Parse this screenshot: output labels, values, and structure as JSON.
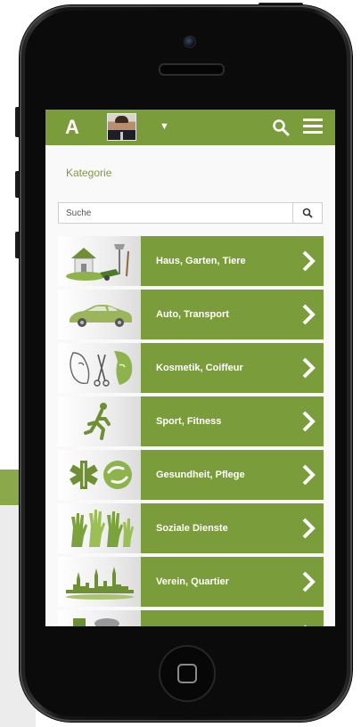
{
  "header": {
    "logo_text": "A",
    "profile_menu_caret": "▼"
  },
  "page": {
    "section_title": "Kategorie"
  },
  "search": {
    "placeholder": "Suche"
  },
  "categories": [
    {
      "label": "Haus, Garten, Tiere",
      "icon": "house-garden-icon"
    },
    {
      "label": "Auto, Transport",
      "icon": "car-icon"
    },
    {
      "label": "Kosmetik, Coiffeur",
      "icon": "cosmetics-icon"
    },
    {
      "label": "Sport, Fitness",
      "icon": "runner-icon"
    },
    {
      "label": "Gesundheit, Pflege",
      "icon": "health-icon"
    },
    {
      "label": "Soziale Dienste",
      "icon": "hands-icon"
    },
    {
      "label": "Verein, Quartier",
      "icon": "cityscape-icon"
    },
    {
      "label": "",
      "icon": "more-icon"
    }
  ],
  "colors": {
    "brand_green": "#7b9c3b",
    "screen_bg": "#f9f9f9"
  }
}
